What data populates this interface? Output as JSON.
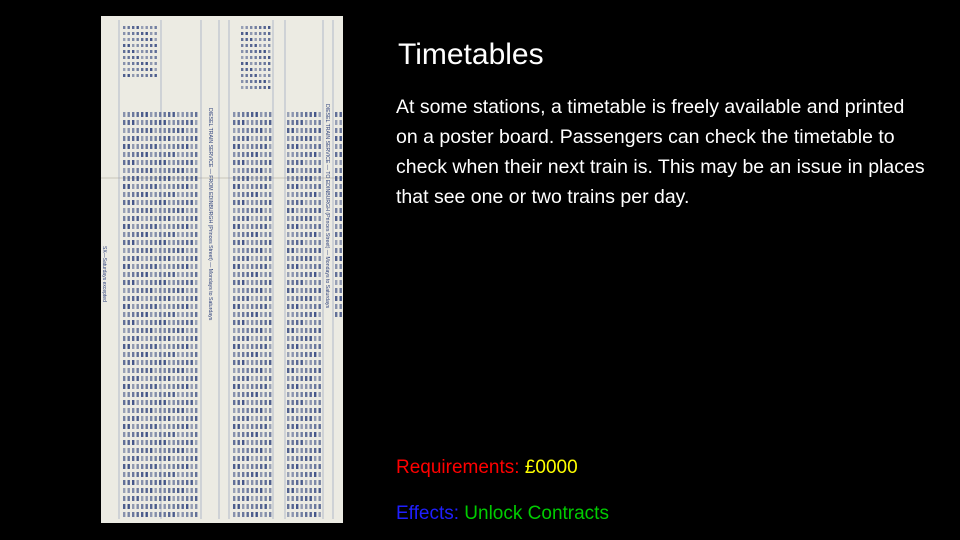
{
  "slide": {
    "title": "Timetables",
    "description": "At some stations, a timetable is freely available and printed on a poster board. Passengers can check the timetable to check when their next train is. This may be an issue in places that see one or two trains per day.",
    "requirements": {
      "label": "Requirements:",
      "value": "£0000"
    },
    "effects": {
      "label": "Effects:",
      "value": "Unlock Contracts"
    }
  },
  "colors": {
    "background": "#000000",
    "text": "#ffffff",
    "requirements_label": "#ff0000",
    "requirements_value": "#ffff00",
    "effects_label": "#1f1fff",
    "effects_value": "#00cc00"
  },
  "image": {
    "icon": "timetable-photo",
    "headers": [
      "DIESEL TRAIN SERVICE — TO EDINBURGH (Princes Street) — Mondays to Saturdays",
      "DIESEL TRAIN SERVICE — FROM EDINBURGH (Princes Street) — Mondays to Saturdays"
    ],
    "footnote": "SX—Saturdays excepted"
  }
}
